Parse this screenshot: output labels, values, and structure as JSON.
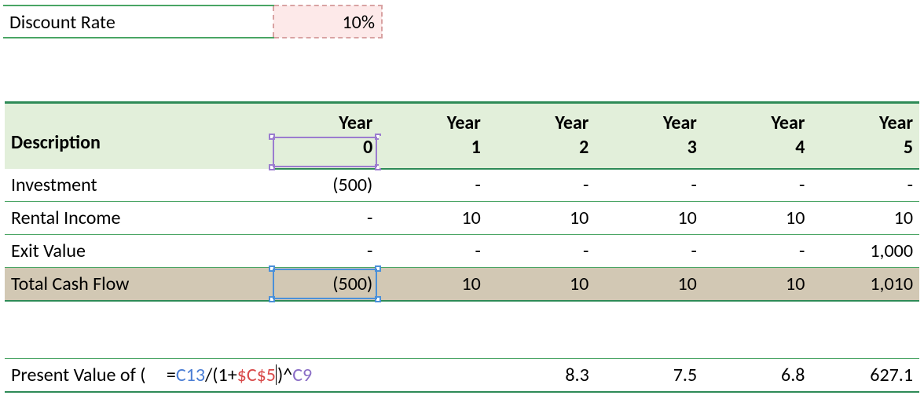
{
  "discount": {
    "label": "Discount Rate",
    "value": "10%"
  },
  "headers": {
    "description": "Description",
    "year_word": "Year",
    "years": [
      "0",
      "1",
      "2",
      "3",
      "4",
      "5"
    ]
  },
  "rows": {
    "investment": {
      "label": "Investment",
      "vals": [
        "(500)",
        "-",
        "-",
        "-",
        "-",
        "-"
      ]
    },
    "rental": {
      "label": "Rental Income",
      "vals": [
        "-",
        "10",
        "10",
        "10",
        "10",
        "10"
      ]
    },
    "exit": {
      "label": "Exit Value",
      "vals": [
        "-",
        "-",
        "-",
        "-",
        "-",
        "1,000"
      ]
    },
    "total": {
      "label": "Total Cash Flow",
      "vals": [
        "(500)",
        "10",
        "10",
        "10",
        "10",
        "1,010"
      ]
    }
  },
  "pv": {
    "label": "Present Value of (",
    "formula": {
      "eq": "=",
      "c13": "C13",
      "div": "/(1+",
      "c5": "$C$5",
      "close": ")",
      "caret_sym": "^",
      "c9": "C9"
    },
    "vals": [
      "",
      "",
      "8.3",
      "7.5",
      "6.8",
      "627.1"
    ]
  },
  "chart_data": {
    "type": "table",
    "discount_rate": 0.1,
    "years": [
      0,
      1,
      2,
      3,
      4,
      5
    ],
    "investment": [
      -500,
      null,
      null,
      null,
      null,
      null
    ],
    "rental_income": [
      null,
      10,
      10,
      10,
      10,
      10
    ],
    "exit_value": [
      null,
      null,
      null,
      null,
      null,
      1000
    ],
    "total_cash_flow": [
      -500,
      10,
      10,
      10,
      10,
      1010
    ],
    "present_value": [
      null,
      null,
      8.3,
      7.5,
      6.8,
      627.1
    ],
    "formula_shown": "=C13/(1+$C$5)^C9"
  }
}
